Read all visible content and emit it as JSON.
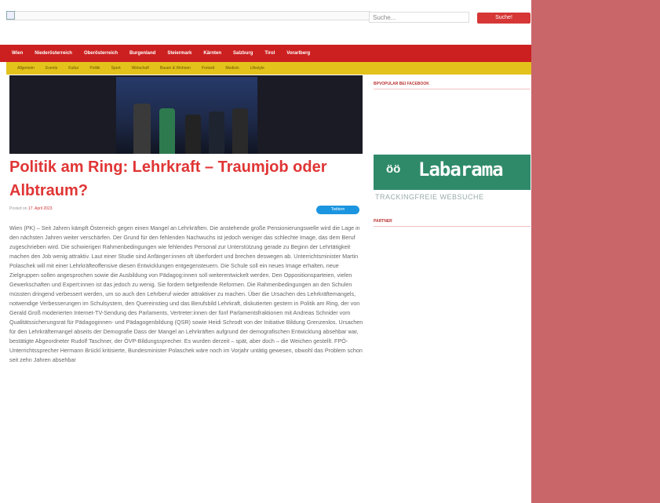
{
  "header": {
    "search_placeholder": "Suche...",
    "search_button": "Suche!"
  },
  "nav_main": [
    "Wien",
    "Niederösterreich",
    "Oberösterreich",
    "Burgenland",
    "Steiermark",
    "Kärnten",
    "Salzburg",
    "Tirol",
    "Vorarlberg"
  ],
  "nav_sub": [
    "Allgemein",
    "Events",
    "Kultur",
    "Politik",
    "Sport",
    "Wirtschaft",
    "Bauen & Wohnen",
    "Freizeit",
    "Medizin",
    "Lifestyle"
  ],
  "article": {
    "title": "Politik am Ring: Lehrkraft – Traumjob oder Albtraum?",
    "posted_label": "Posted on",
    "posted_date": "17. April 2023",
    "tweet_label": "Twittern",
    "body": "Wien (PK) – Seit Jahren kämpft Österreich gegen einen Mangel an Lehrkräften. Die anstehende große Pensionierungswelle wird die Lage in den nächsten Jahren weiter verschärfen. Der Grund für den fehlenden Nachwuchs ist jedoch weniger das schlechte Image, das dem Beruf zugeschrieben wird. Die schwierigen Rahmenbedingungen wie fehlendes Personal zur Unterstützung gerade zu Beginn der Lehrtätigkeit machen den Job wenig attraktiv. Laut einer Studie sind Anfänger:innen oft überfordert und brechen deswegen ab. Unterrichtsminister Martin Polaschek will mit einer Lehrkräfteoffensive diesen Entwicklungen entgegensteuern. Die Schule soll ein neues Image erhalten, neue Zielgruppen sollen angesprochen sowie die Ausbildung von Pädagog:innen soll weiterentwickelt werden. Den Oppositionsparteien, vielen Gewerkschaften und Expert:innen ist das jedoch zu wenig. Sie fordern tiefgreifende Reformen. Die Rahmenbedingungen an den Schulen müssten dringend verbessert werden, um so auch den Lehrberuf wieder attraktiver zu machen. Über die Ursachen des Lehrkräftemangels, notwendige Verbesserungen im Schulsystem, den Quereinstieg und das Berufsbild Lehrkraft, diskutierten gestern in Politik am Ring, der von Gerald Groß moderierten Internet-TV-Sendung des Parlaments, Vertreter:innen der fünf Parlamentsfraktionen mit Andreas Schnider vom Qualitätssicherungsrat für Pädagoginnen- und Pädagogenbildung (QSR) sowie Heidi Schrodt von der Initiative Bildung Grenzenlos. Ursachen für den Lehrkräftemangel abseits der Demografie Dass der Mangel an Lehrkräften aufgrund der demografischen Entwicklung absehbar war, bestätigte Abgeordneter Rudolf Taschner, der ÖVP-Bildungssprecher. Es wurden derzeit – spät, aber doch – die Weichen gestellt. FPÖ-Unterrichtssprecher Hermann Brückl kritisierte, Bundesminister Polaschek wäre noch im Vorjahr untätig gewesen, obwohl das Problem schon seit zehn Jahren absehbar"
  },
  "sidebar": {
    "facebook_heading": "BPVOPULAR BEI FACEBOOK",
    "partner_heading": "PARTNER",
    "labarama_icon": "öö",
    "labarama_name": "Labarama",
    "labarama_tagline": "TRACKINGFREIE WEBSUCHE"
  },
  "colors": {
    "nav_red": "#cc2020",
    "nav_yellow": "#e3c21c",
    "headline": "#e03535",
    "right_panel": "#c8666a",
    "labarama": "#2f8a6a"
  }
}
